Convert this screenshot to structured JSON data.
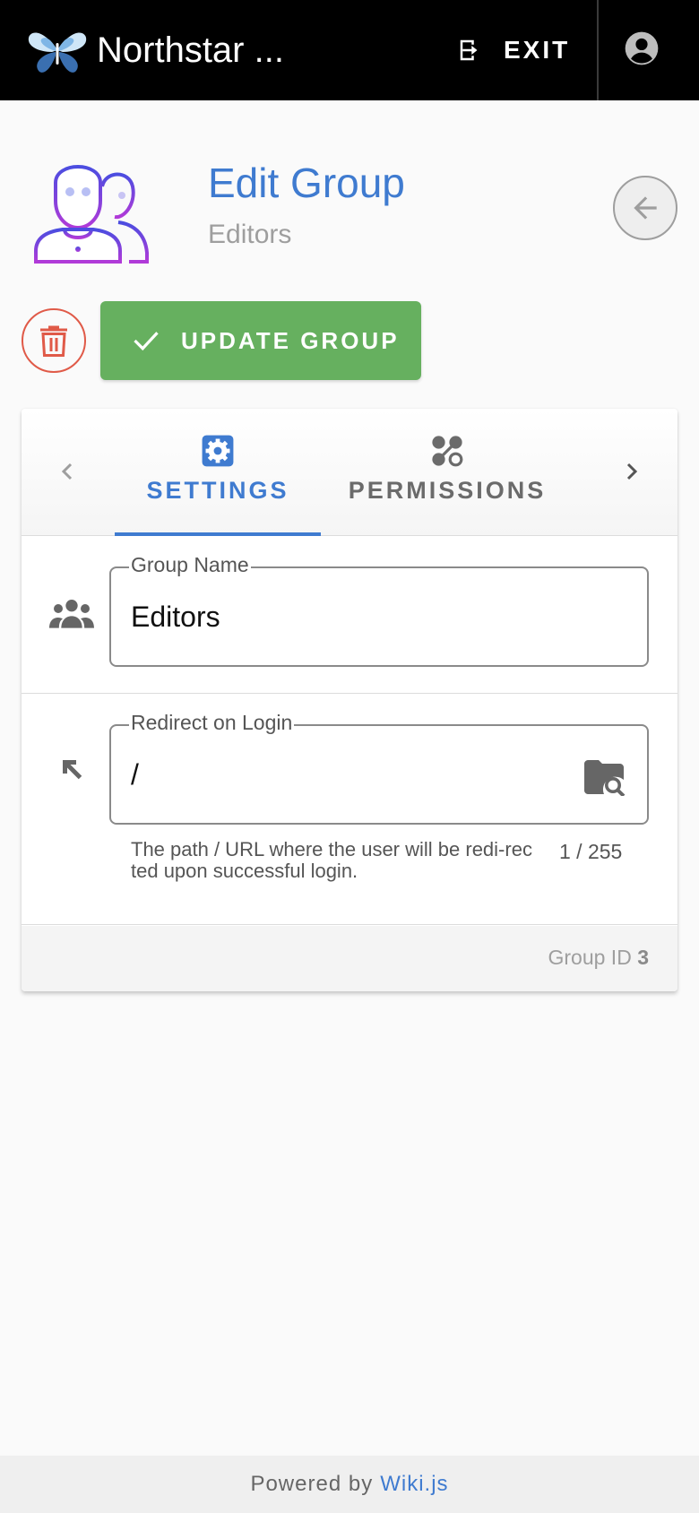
{
  "app": {
    "site_title": "Northstar ...",
    "exit_label": "EXIT"
  },
  "header": {
    "title": "Edit Group",
    "subtitle": "Editors"
  },
  "actions": {
    "update_label": "UPDATE GROUP"
  },
  "tabs": [
    {
      "label": "SETTINGS",
      "active": true
    },
    {
      "label": "PERMISSIONS",
      "active": false
    }
  ],
  "form": {
    "group_name": {
      "label": "Group Name",
      "value": "Editors"
    },
    "redirect": {
      "label": "Redirect on Login",
      "value": "/",
      "hint": "The path / URL where the user will be redi-rected upon successful login.",
      "counter": "1 / 255"
    }
  },
  "card_footer": {
    "group_id_label": "Group ID",
    "group_id_value": "3"
  },
  "footer": {
    "powered_by": "Powered by",
    "link_text": "Wiki.js"
  },
  "icons": {
    "logo": "butterfly-logo",
    "exit": "exit-icon",
    "account": "account-icon",
    "back": "arrow-left-icon",
    "delete": "trash-icon",
    "check": "check-icon",
    "settings": "gear-icon",
    "permissions": "permissions-icon",
    "group_name": "group-icon",
    "redirect": "arrow-top-left-icon",
    "browse": "folder-search-icon"
  },
  "colors": {
    "accent": "#3f7bd0",
    "success": "#66b05f",
    "danger": "#e05a48",
    "topbar": "#000000"
  }
}
